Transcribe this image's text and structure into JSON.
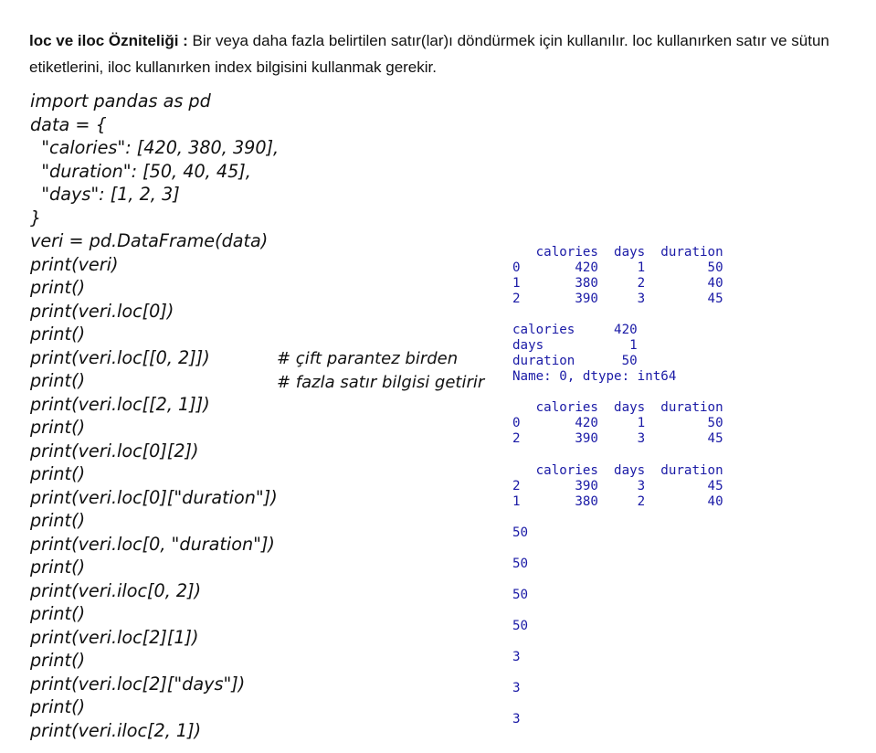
{
  "intro": {
    "title": "loc ve iloc Özniteliği :",
    "text": " Bir veya daha fazla belirtilen satır(lar)ı döndürmek için kullanılır. loc kullanırken satır ve sütun etiketlerini, iloc kullanırken index bilgisini kullanmak gerekir."
  },
  "code_lines": [
    "import pandas as pd",
    "data = {",
    "  \"calories\": [420, 380, 390],",
    "  \"duration\": [50, 40, 45],",
    "  \"days\": [1, 2, 3]",
    "}",
    "veri = pd.DataFrame(data)",
    "print(veri)",
    "print()",
    "print(veri.loc[0])",
    "print()",
    "print(veri.loc[[0, 2]])",
    "print()",
    "print(veri.loc[[2, 1]])",
    "print()",
    "print(veri.loc[0][2])",
    "print()",
    "print(veri.loc[0][\"duration\"])",
    "print()",
    "print(veri.loc[0, \"duration\"])",
    "print()",
    "print(veri.iloc[0, 2])",
    "print()",
    "print(veri.loc[2][1])",
    "print()",
    "print(veri.loc[2][\"days\"])",
    "print()",
    "print(veri.iloc[2, 1])"
  ],
  "comment_lines": [
    "# çift parantez birden",
    "# fazla satır bilgisi getirir"
  ],
  "outputs": [
    "   calories  days  duration\n0       420     1        50\n1       380     2        40\n2       390     3        45",
    "calories     420\ndays           1\nduration      50\nName: 0, dtype: int64",
    "   calories  days  duration\n0       420     1        50\n2       390     3        45",
    "   calories  days  duration\n2       390     3        45\n1       380     2        40",
    "50",
    "50",
    "50",
    "50",
    "3",
    "3",
    "3"
  ]
}
